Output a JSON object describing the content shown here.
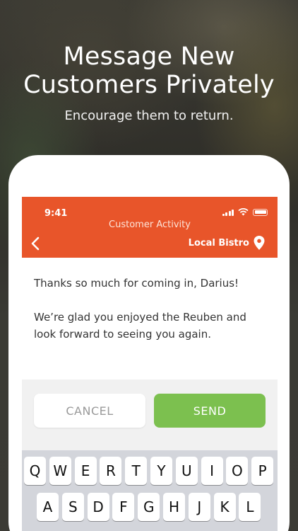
{
  "promo": {
    "headline_line1": "Message New",
    "headline_line2": "Customers Privately",
    "subheadline": "Encourage them to return."
  },
  "status_bar": {
    "time": "9:41"
  },
  "app_bar": {
    "title": "Customer Activity",
    "location_name": "Local Bistro",
    "accent_color": "#e8552a"
  },
  "message": {
    "line1": "Thanks so much for coming in, Darius!",
    "line2": "We’re glad you enjoyed the Reuben and",
    "line3": "look forward to seeing you again."
  },
  "actions": {
    "cancel_label": "CANCEL",
    "send_label": "SEND",
    "send_color": "#7cc04f"
  },
  "keyboard": {
    "row1": [
      "Q",
      "W",
      "E",
      "R",
      "T",
      "Y",
      "U",
      "I",
      "O",
      "P"
    ],
    "row2": [
      "A",
      "S",
      "D",
      "F",
      "G",
      "H",
      "J",
      "K",
      "L"
    ]
  }
}
